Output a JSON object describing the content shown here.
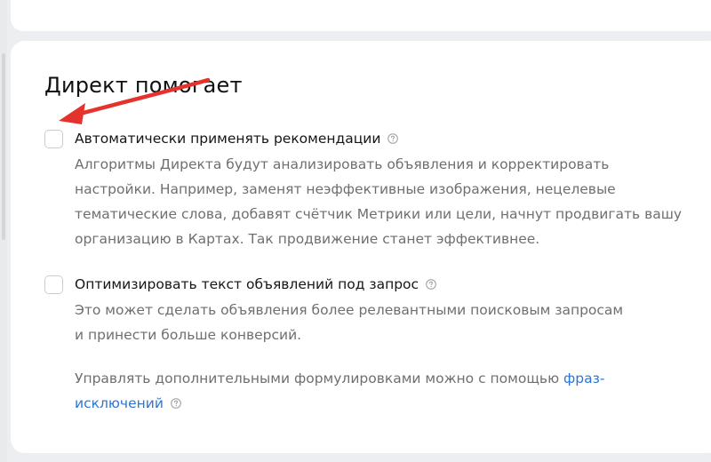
{
  "section": {
    "title": "Директ помогает"
  },
  "options": [
    {
      "label": "Автоматически применять рекомендации",
      "checked": false,
      "help_icon": "question-circle-icon",
      "description_lines": [
        "Алгоритмы Директа будут анализировать объявления и корректировать",
        "настройки. Например, заменят неэффективные изображения, нецелевые",
        "тематические слова, добавят счётчик Метрики или цели, начнут продвигать вашу",
        "организацию в Картах. Так продвижение станет эффективнее."
      ]
    },
    {
      "label": "Оптимизировать текст объявлений под запрос",
      "checked": false,
      "help_icon": "question-circle-icon",
      "description_lines": [
        "Это может сделать объявления более релевантными поисковым запросам",
        "и принести больше конверсий."
      ]
    }
  ],
  "manage": {
    "text": "Управлять дополнительными формулировками можно с помощью ",
    "link_part1": "фраз-",
    "link_part2": "исключений",
    "help_icon": "question-circle-icon"
  },
  "annotation": {
    "arrow_color": "#e5322d"
  },
  "colors": {
    "background": "#eceef1",
    "card": "#ffffff",
    "secondary_text": "#6f6f73",
    "link": "#2a76d8"
  }
}
